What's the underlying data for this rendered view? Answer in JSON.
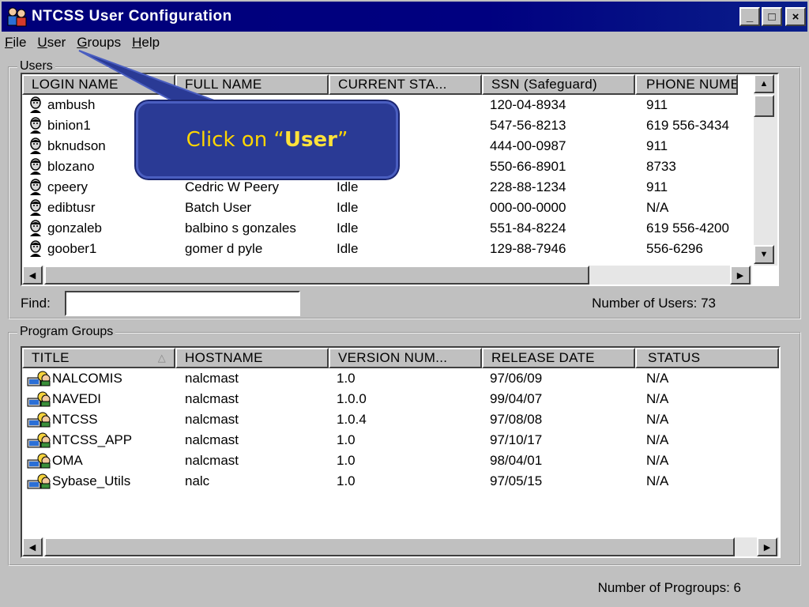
{
  "window": {
    "title": "NTCSS User Configuration",
    "controls": {
      "minimize": "_",
      "maximize": "□",
      "close": "×"
    }
  },
  "menu": [
    {
      "label": "File",
      "key": "F",
      "rest": "ile"
    },
    {
      "label": "User",
      "key": "U",
      "rest": "ser"
    },
    {
      "label": "Groups",
      "key": "G",
      "rest": "roups"
    },
    {
      "label": "Help",
      "key": "H",
      "rest": "elp"
    }
  ],
  "users": {
    "group_label": "Users",
    "columns": [
      "LOGIN NAME",
      "FULL NAME",
      "CURRENT STA...",
      "SSN (Safeguard)",
      "PHONE NUMB"
    ],
    "rows": [
      {
        "login": "ambush",
        "full": "",
        "status": "",
        "ssn": "120-04-8934",
        "phone": "911"
      },
      {
        "login": "binion1",
        "full": "",
        "status": "",
        "ssn": "547-56-8213",
        "phone": "619 556-3434"
      },
      {
        "login": "bknudson",
        "full": "",
        "status": "",
        "ssn": "444-00-0987",
        "phone": "911"
      },
      {
        "login": "blozano",
        "full": "",
        "status": "",
        "ssn": "550-66-8901",
        "phone": "8733"
      },
      {
        "login": "cpeery",
        "full": "Cedric W Peery",
        "status": "Idle",
        "ssn": "228-88-1234",
        "phone": "911"
      },
      {
        "login": "edibtusr",
        "full": "Batch User",
        "status": "Idle",
        "ssn": "000-00-0000",
        "phone": "N/A"
      },
      {
        "login": "gonzaleb",
        "full": "balbino s gonzales",
        "status": "Idle",
        "ssn": "551-84-8224",
        "phone": "619 556-4200"
      },
      {
        "login": "goober1",
        "full": "gomer d pyle",
        "status": "Idle",
        "ssn": "129-88-7946",
        "phone": "556-6296"
      }
    ],
    "find_label": "Find:",
    "find_value": "",
    "count_text": "Number of Users: 73"
  },
  "groups": {
    "group_label": "Program Groups",
    "columns": [
      "TITLE",
      "HOSTNAME",
      "VERSION NUM...",
      "RELEASE DATE",
      "STATUS"
    ],
    "rows": [
      {
        "title": "NALCOMIS",
        "host": "nalcmast",
        "version": "1.0",
        "release": "97/06/09",
        "status": "N/A"
      },
      {
        "title": "NAVEDI",
        "host": "nalcmast",
        "version": "1.0.0",
        "release": "99/04/07",
        "status": "N/A"
      },
      {
        "title": "NTCSS",
        "host": "nalcmast",
        "version": "1.0.4",
        "release": "97/08/08",
        "status": "N/A"
      },
      {
        "title": "NTCSS_APP",
        "host": "nalcmast",
        "version": "1.0",
        "release": "97/10/17",
        "status": "N/A"
      },
      {
        "title": "OMA",
        "host": "nalcmast",
        "version": "1.0",
        "release": "98/04/01",
        "status": "N/A"
      },
      {
        "title": "Sybase_Utils",
        "host": "nalc",
        "version": "1.0",
        "release": "97/05/15",
        "status": "N/A"
      }
    ],
    "count_text": "Number of Progroups: 6"
  },
  "callout": {
    "prefix": "Click on “",
    "highlight": "User",
    "suffix": "”"
  },
  "colors": {
    "titlebar": "#000080",
    "callout_bg": "#2a3a95",
    "callout_text": "#ffd600",
    "face": "#c0c0c0"
  },
  "icons": {
    "user_row": "user-head-icon",
    "group_row": "program-group-icon",
    "app": "ntcss-app-icon"
  }
}
